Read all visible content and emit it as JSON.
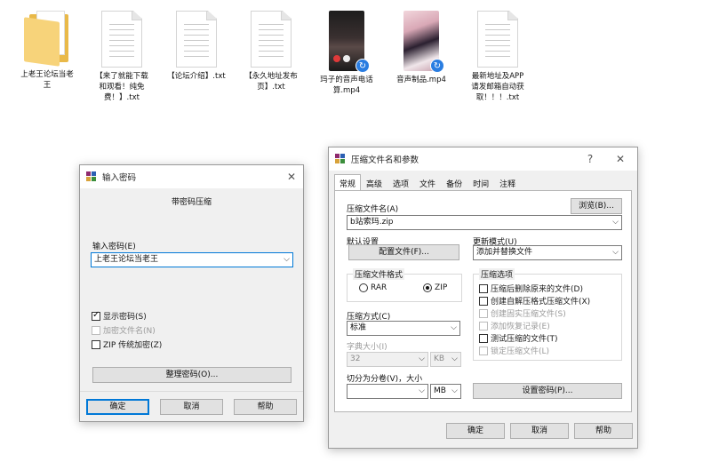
{
  "desktop": {
    "files": [
      {
        "caption": "上老王论坛当老\n王",
        "kind": "folder"
      },
      {
        "caption": "【来了就能下载\n和观看！纯免\n费！】.txt",
        "kind": "txt"
      },
      {
        "caption": "【论坛介绍】.txt",
        "kind": "txt"
      },
      {
        "caption": "【永久地址发布\n页】.txt",
        "kind": "txt"
      },
      {
        "caption": "玛子的音声电话\n算.mp4",
        "kind": "mp4"
      },
      {
        "caption": "音声制品.mp4",
        "kind": "mp4"
      },
      {
        "caption": "最新地址及APP\n请发邮箱自动获\n取！！！.txt",
        "kind": "txt"
      }
    ]
  },
  "password_dialog": {
    "title": "输入密码",
    "heading": "带密码压缩",
    "password_label": "输入密码(E)",
    "password_value": "上老王论坛当老王",
    "show_password": "显示密码(S)",
    "encrypt_filenames": "加密文件名(N)",
    "zip_legacy": "ZIP 传统加密(Z)",
    "organize_button": "整理密码(O)...",
    "ok": "确定",
    "cancel": "取消",
    "help": "帮助"
  },
  "archive_dialog": {
    "title": "压缩文件名和参数",
    "help_glyph": "?",
    "tabs": [
      "常规",
      "高级",
      "选项",
      "文件",
      "备份",
      "时间",
      "注释"
    ],
    "archive_name_label": "压缩文件名(A)",
    "browse_button": "浏览(B)...",
    "archive_name_value": "b站索玛.zip",
    "default_settings_label": "默认设置",
    "profiles_button": "配置文件(F)...",
    "update_mode_label": "更新模式(U)",
    "update_mode_value": "添加并替换文件",
    "format_group": "压缩文件格式",
    "format_rar": "RAR",
    "format_zip": "ZIP",
    "options_group": "压缩选项",
    "opt_delete": "压缩后删除原来的文件(D)",
    "opt_sfx": "创建自解压格式压缩文件(X)",
    "opt_solid": "创建固实压缩文件(S)",
    "opt_recovery": "添加恢复记录(E)",
    "opt_test": "测试压缩的文件(T)",
    "opt_lock": "锁定压缩文件(L)",
    "method_label": "压缩方式(C)",
    "method_value": "标准",
    "dict_label": "字典大小(I)",
    "dict_value": "32",
    "dict_unit": "KB",
    "split_label": "切分为分卷(V)，大小",
    "split_value": "",
    "split_unit": "MB",
    "set_password_button": "设置密码(P)...",
    "ok": "确定",
    "cancel": "取消",
    "help": "帮助"
  },
  "colors": {
    "accent": "#0078d7",
    "folder": "#e9b949",
    "badge": "#2a7de1"
  }
}
